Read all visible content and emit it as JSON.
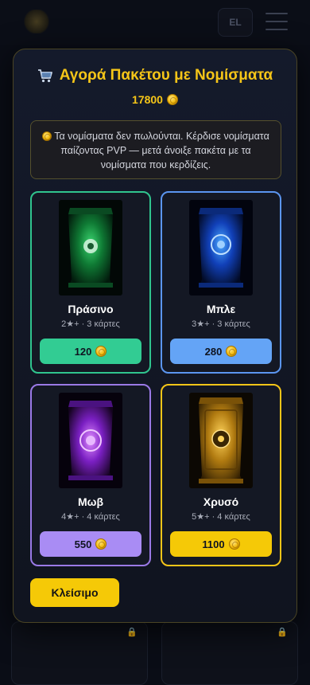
{
  "header": {
    "language": "EL"
  },
  "modal": {
    "title": "Αγορά Πακέτου με Νομίσματα",
    "balance": "17800",
    "info": "Τα νομίσματα δεν πωλούνται. Κέρδισε νομίσματα παίζοντας PVP — μετά άνοιξε πακέτα με τα νομίσματα που κερδίζεις.",
    "packs": [
      {
        "name": "Πράσινο",
        "meta": "2★+ · 3 κάρτες",
        "price": "120"
      },
      {
        "name": "Μπλε",
        "meta": "3★+ · 3 κάρτες",
        "price": "280"
      },
      {
        "name": "Μωβ",
        "meta": "4★+ · 4 κάρτες",
        "price": "550"
      },
      {
        "name": "Χρυσό",
        "meta": "5★+ · 4 κάρτες",
        "price": "1100"
      }
    ],
    "close_label": "Κλείσιμο"
  },
  "colors": {
    "accent": "#f5c518",
    "green": "#30c48e",
    "blue": "#5b95f0",
    "purple": "#9a79e6",
    "gold": "#f5c518"
  }
}
